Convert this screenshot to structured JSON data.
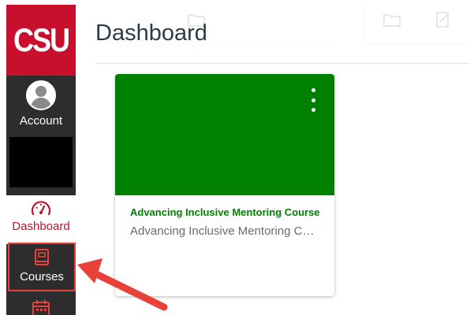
{
  "nav": {
    "logo_text": "CSU",
    "account_label": "Account",
    "dashboard_label": "Dashboard",
    "courses_label": "Courses"
  },
  "main": {
    "title": "Dashboard",
    "card": {
      "title": "Advancing Inclusive Mentoring Course",
      "subtitle": "Advancing Inclusive Mentoring Course",
      "color": "#008000"
    }
  },
  "colors": {
    "brand_red": "#c8102e",
    "nav_bg": "#2d2d2d",
    "annotation_red": "#e8413a"
  }
}
